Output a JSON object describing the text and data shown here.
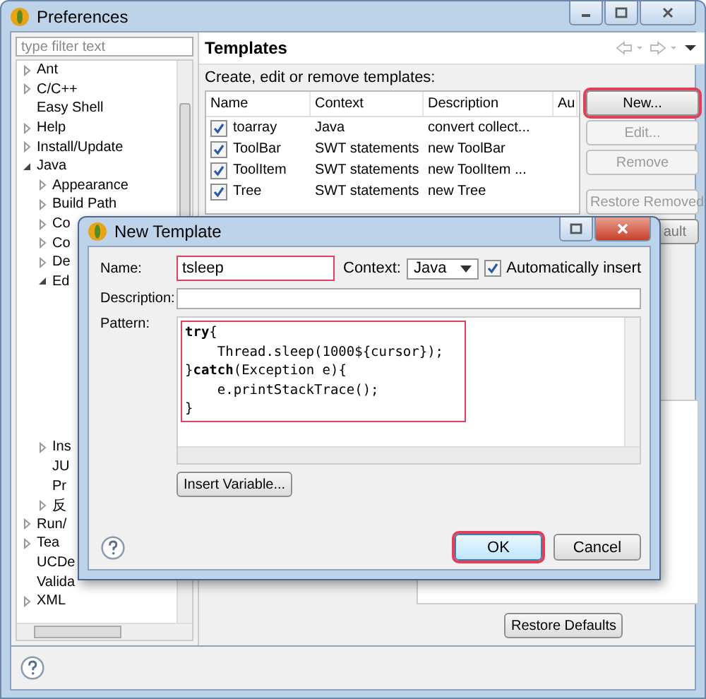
{
  "window": {
    "title": "Preferences"
  },
  "filter": {
    "placeholder": "type filter text"
  },
  "tree": [
    {
      "label": "Ant",
      "kind": "folder",
      "expanded": false
    },
    {
      "label": "C/C++",
      "kind": "folder",
      "expanded": false
    },
    {
      "label": "Easy Shell",
      "kind": "leaf"
    },
    {
      "label": "Help",
      "kind": "folder",
      "expanded": false
    },
    {
      "label": "Install/Update",
      "kind": "folder",
      "expanded": false
    },
    {
      "label": "Java",
      "kind": "folder",
      "expanded": true,
      "children": [
        {
          "label": "Appearance",
          "kind": "folder",
          "expanded": false
        },
        {
          "label": "Build Path",
          "kind": "folder",
          "expanded": false
        },
        {
          "label": "Co",
          "kind": "folder",
          "expanded": false
        },
        {
          "label": "Co",
          "kind": "folder",
          "expanded": false
        },
        {
          "label": "De",
          "kind": "folder",
          "expanded": false
        },
        {
          "label": "Ed",
          "kind": "folder",
          "expanded": true
        },
        {
          "label": "Ins",
          "kind": "folder",
          "expanded": false
        },
        {
          "label": "JU",
          "kind": "leaf"
        },
        {
          "label": "Pr",
          "kind": "leaf"
        },
        {
          "label": "反",
          "kind": "folder",
          "expanded": false
        }
      ]
    },
    {
      "label": "Run/",
      "kind": "folder",
      "expanded": false
    },
    {
      "label": "Tea",
      "kind": "folder",
      "expanded": false
    },
    {
      "label": "UCDe",
      "kind": "leaf"
    },
    {
      "label": "Valida",
      "kind": "leaf"
    },
    {
      "label": "XML",
      "kind": "folder",
      "expanded": false
    }
  ],
  "page": {
    "title": "Templates",
    "intro": "Create, edit or remove templates:"
  },
  "table": {
    "columns": [
      "Name",
      "Context",
      "Description",
      "Au"
    ],
    "rows": [
      {
        "checked": true,
        "cells": [
          "toarray",
          "Java",
          "convert collect..."
        ]
      },
      {
        "checked": true,
        "cells": [
          "ToolBar",
          "SWT statements",
          "new ToolBar"
        ]
      },
      {
        "checked": true,
        "cells": [
          "ToolItem",
          "SWT statements",
          "new ToolItem ..."
        ]
      },
      {
        "checked": true,
        "cells": [
          "Tree",
          "SWT statements",
          "new Tree"
        ]
      }
    ]
  },
  "buttons": [
    {
      "label": "New...",
      "disabled": false,
      "highlighted": true,
      "kind": "full"
    },
    {
      "label": "Edit...",
      "disabled": true,
      "highlighted": false,
      "kind": "full"
    },
    {
      "label": "Remove",
      "disabled": true,
      "highlighted": false,
      "kind": "full"
    },
    {
      "label": "Restore Removed",
      "disabled": true,
      "highlighted": false,
      "kind": "full"
    },
    {
      "label": "ault",
      "disabled": false,
      "highlighted": false,
      "kind": "tail"
    }
  ],
  "restore_defaults": "Restore Defaults",
  "dialog": {
    "title": "New Template",
    "name_label": "Name:",
    "name_value": "tsleep",
    "name_highlighted": true,
    "context_label": "Context:",
    "context_value": "Java",
    "auto_insert": {
      "label": "Automatically insert",
      "checked": true
    },
    "description_label": "Description:",
    "pattern_label": "Pattern:",
    "pattern_lines": [
      "**try**{",
      "    Thread.sleep(1000${cursor});",
      "}**catch**(Exception e){",
      "    e.printStackTrace();",
      "}"
    ],
    "pattern_highlighted": true,
    "insert_variable": "Insert Variable...",
    "buttons": [
      {
        "label": "OK",
        "highlighted": true
      },
      {
        "label": "Cancel",
        "highlighted": false
      }
    ]
  }
}
